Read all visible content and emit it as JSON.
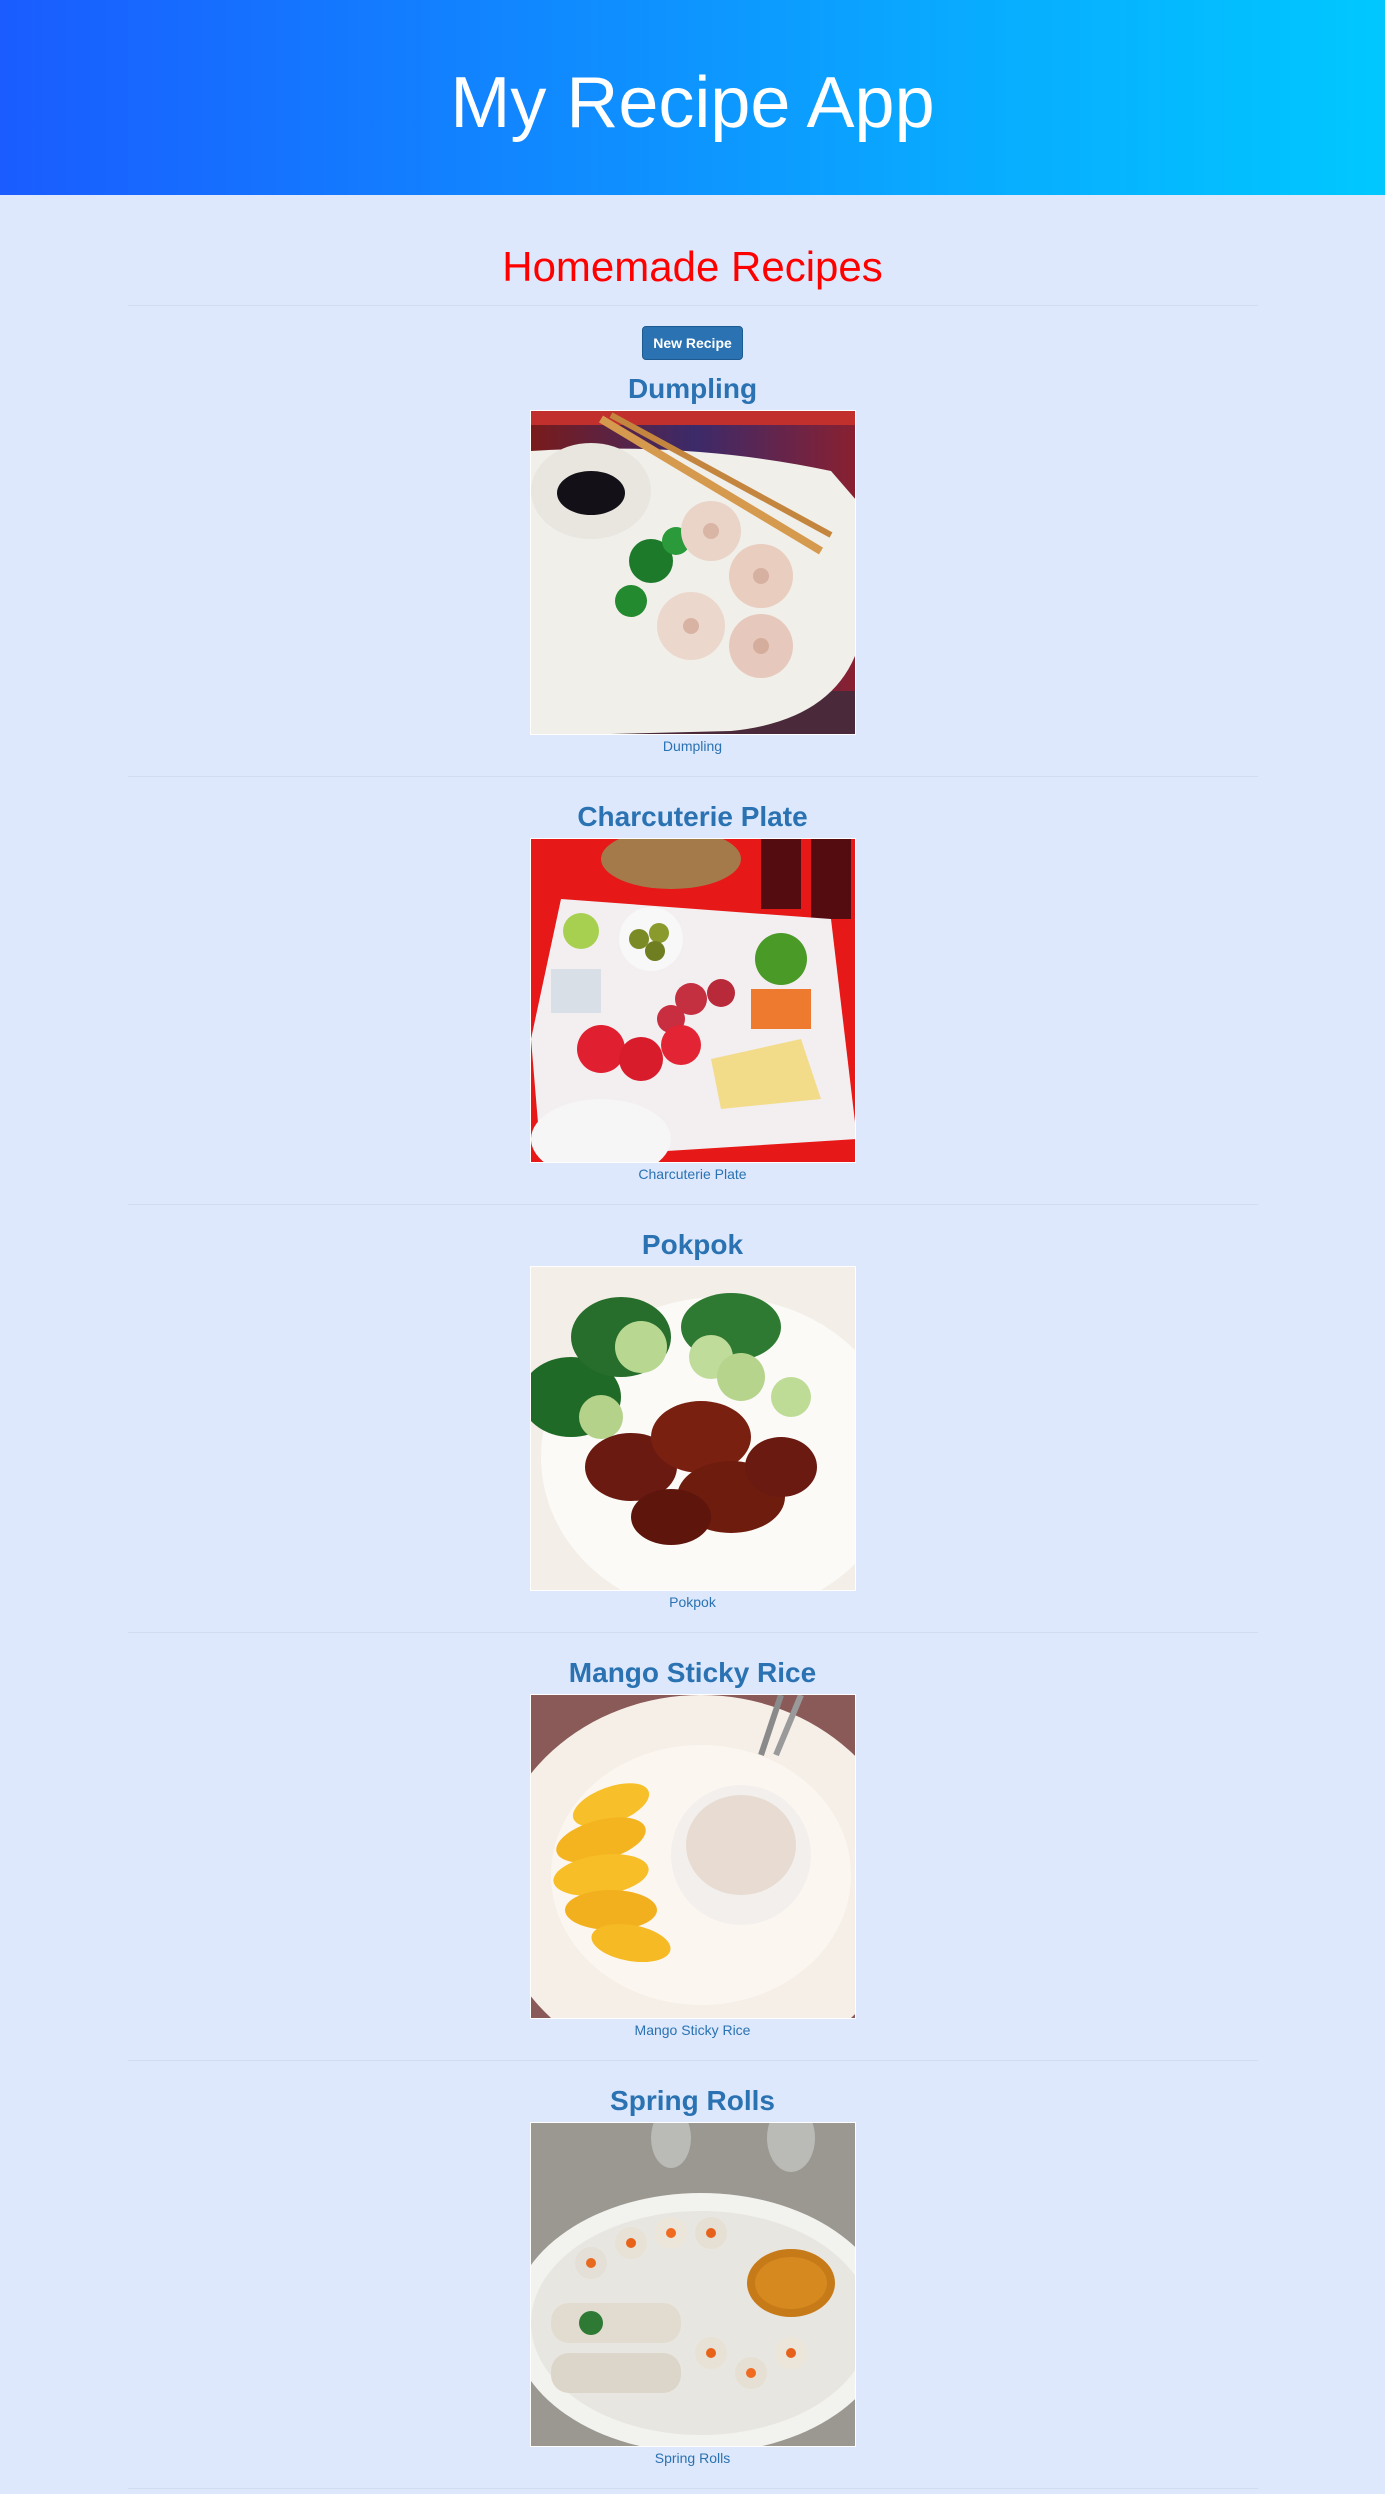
{
  "header": {
    "app_title": "My Recipe App"
  },
  "main": {
    "page_title": "Homemade Recipes",
    "new_recipe_label": "New Recipe"
  },
  "recipes": [
    {
      "title": "Dumpling",
      "caption": "Dumpling",
      "photo": "dumpling-photo"
    },
    {
      "title": "Charcuterie Plate",
      "caption": "Charcuterie Plate",
      "photo": "charcuterie-photo"
    },
    {
      "title": "Pokpok",
      "caption": "Pokpok",
      "photo": "pokpok-wings-photo"
    },
    {
      "title": "Mango Sticky Rice",
      "caption": "Mango Sticky Rice",
      "photo": "mango-sticky-rice-photo"
    },
    {
      "title": "Spring Rolls",
      "caption": "Spring Rolls",
      "photo": "spring-rolls-photo"
    }
  ],
  "colors": {
    "background": "#dde8fc",
    "hero_gradient_start": "#1a5cff",
    "hero_gradient_end": "#00c8ff",
    "page_title": "#ff0000",
    "link_blue": "#2a72b2",
    "button_bg": "#2a72b2"
  }
}
